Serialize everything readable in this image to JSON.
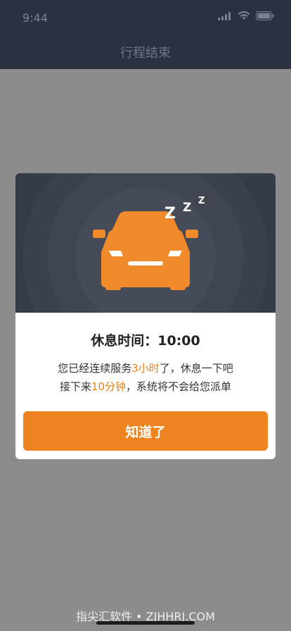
{
  "status_bar": {
    "time": "9:44",
    "icons": [
      "signal-icon",
      "wifi-icon",
      "battery-icon"
    ]
  },
  "nav": {
    "title": "行程结束"
  },
  "dialog": {
    "illustration": {
      "icons": [
        "car-icon",
        "sleep-z-icon"
      ],
      "z_text": "Z"
    },
    "title": "休息时间：10:00",
    "message_line1": {
      "before": "您已经连续服务",
      "highlight": "3小时",
      "after": "了，休息一下吧"
    },
    "message_line2": {
      "before": "接下来",
      "highlight": "10分钟",
      "after": "，系统将不会给您派单"
    },
    "button_label": "知道了"
  },
  "watermark": "指尖汇软件 • ZJHHRJ.COM",
  "colors": {
    "accent": "#ee8420",
    "overlay": "#8c8c8c",
    "header": "#2b3140",
    "illustration_bg": "#353b48"
  }
}
